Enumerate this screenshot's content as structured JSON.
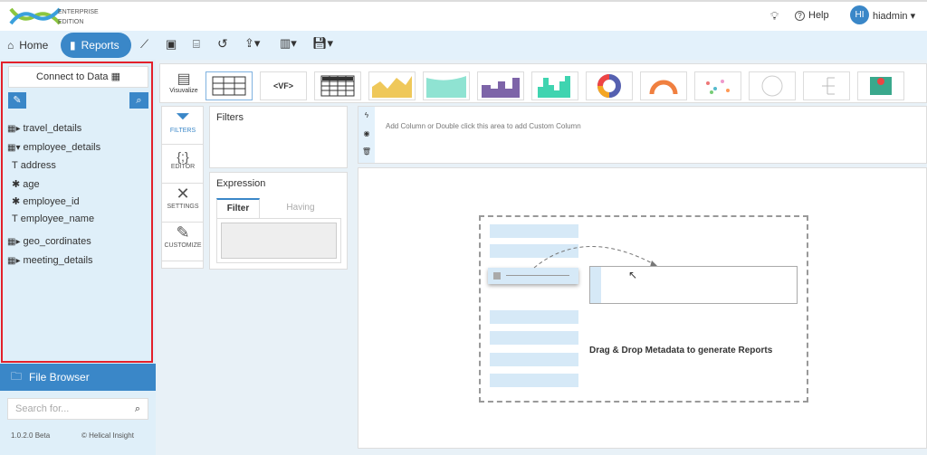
{
  "header": {
    "edition_line1": "ENTERPRISE",
    "edition_line2": "EDITION",
    "help": "Help",
    "avatar_initials": "HI",
    "username": "hiadmin"
  },
  "nav": {
    "home": "Home",
    "reports": "Reports"
  },
  "sidebar": {
    "connect": "Connect to Data",
    "tree": [
      {
        "label": "travel_details",
        "type": "table",
        "expanded": false
      },
      {
        "label": "employee_details",
        "type": "table",
        "expanded": true
      },
      {
        "label": "address",
        "type": "text"
      },
      {
        "label": "age",
        "type": "numeric"
      },
      {
        "label": "employee_id",
        "type": "numeric"
      },
      {
        "label": "employee_name",
        "type": "text"
      },
      {
        "label": "geo_cordinates",
        "type": "table",
        "expanded": false
      },
      {
        "label": "meeting_details",
        "type": "table",
        "expanded": false
      }
    ],
    "file_browser": "File Browser",
    "search_placeholder": "Search for...",
    "version": "1.0.2.0 Beta",
    "copyright": "© Helical Insight"
  },
  "toolbar": {
    "visualize": "Visuvalize",
    "vf_label": "<VF>"
  },
  "side_tabs": [
    "FILTERS",
    "EDITOR",
    "SETTINGS",
    "CUSTOMIZE"
  ],
  "filters": {
    "title": "Filters"
  },
  "expression": {
    "title": "Expression",
    "tab_filter": "Filter",
    "tab_having": "Having"
  },
  "columns": {
    "hint": "Add Column or Double click this area to add Custom Column"
  },
  "dropzone": {
    "message": "Drag & Drop Metadata to generate Reports"
  },
  "colors": {
    "accent": "#3a87c8",
    "sidebar_bg": "#dfeff9",
    "highlight": "#e3202a"
  }
}
